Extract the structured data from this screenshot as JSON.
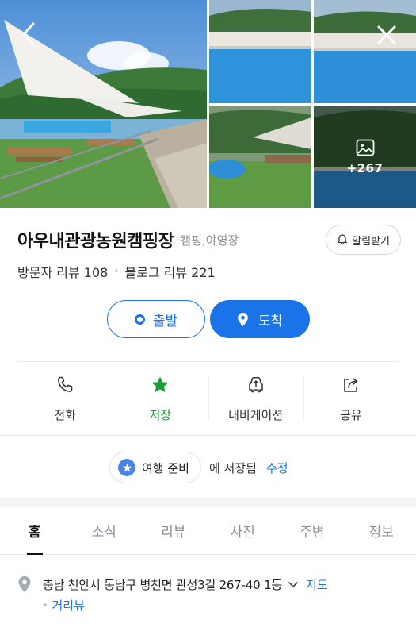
{
  "gallery": {
    "more_count": "+267",
    "icons": {
      "back": "chevron-left-icon",
      "close": "close-icon",
      "more_photos": "image-icon"
    }
  },
  "place": {
    "title": "아우내관광농원캠핑장",
    "category": "캠핑,야영장",
    "alarm_label": "알림받기",
    "visitor_reviews": "방문자 리뷰 108",
    "blog_reviews": "블로그 리뷰 221"
  },
  "route": {
    "depart_label": "출발",
    "arrive_label": "도착"
  },
  "actions": [
    {
      "label": "전화",
      "icon": "phone-icon"
    },
    {
      "label": "저장",
      "icon": "star-icon"
    },
    {
      "label": "내비게이션",
      "icon": "car-navigation-icon"
    },
    {
      "label": "공유",
      "icon": "share-icon"
    }
  ],
  "saved": {
    "folder_name": "여행 준비",
    "saved_text": "에 저장됨",
    "edit_label": "수정"
  },
  "tabs": [
    {
      "label": "홈",
      "active": true
    },
    {
      "label": "소식",
      "active": false
    },
    {
      "label": "리뷰",
      "active": false
    },
    {
      "label": "사진",
      "active": false
    },
    {
      "label": "주변",
      "active": false
    },
    {
      "label": "정보",
      "active": false
    }
  ],
  "address": {
    "text": "충남 천안시 동남구 병천면 관성3길 267-40 1동",
    "map_label": "지도",
    "street_view_label": "거리뷰"
  },
  "colors": {
    "accent": "#1a73e8",
    "saved_green": "#1e9c3c",
    "divider": "#e6e8eb",
    "muted_text": "#8a8f98"
  }
}
